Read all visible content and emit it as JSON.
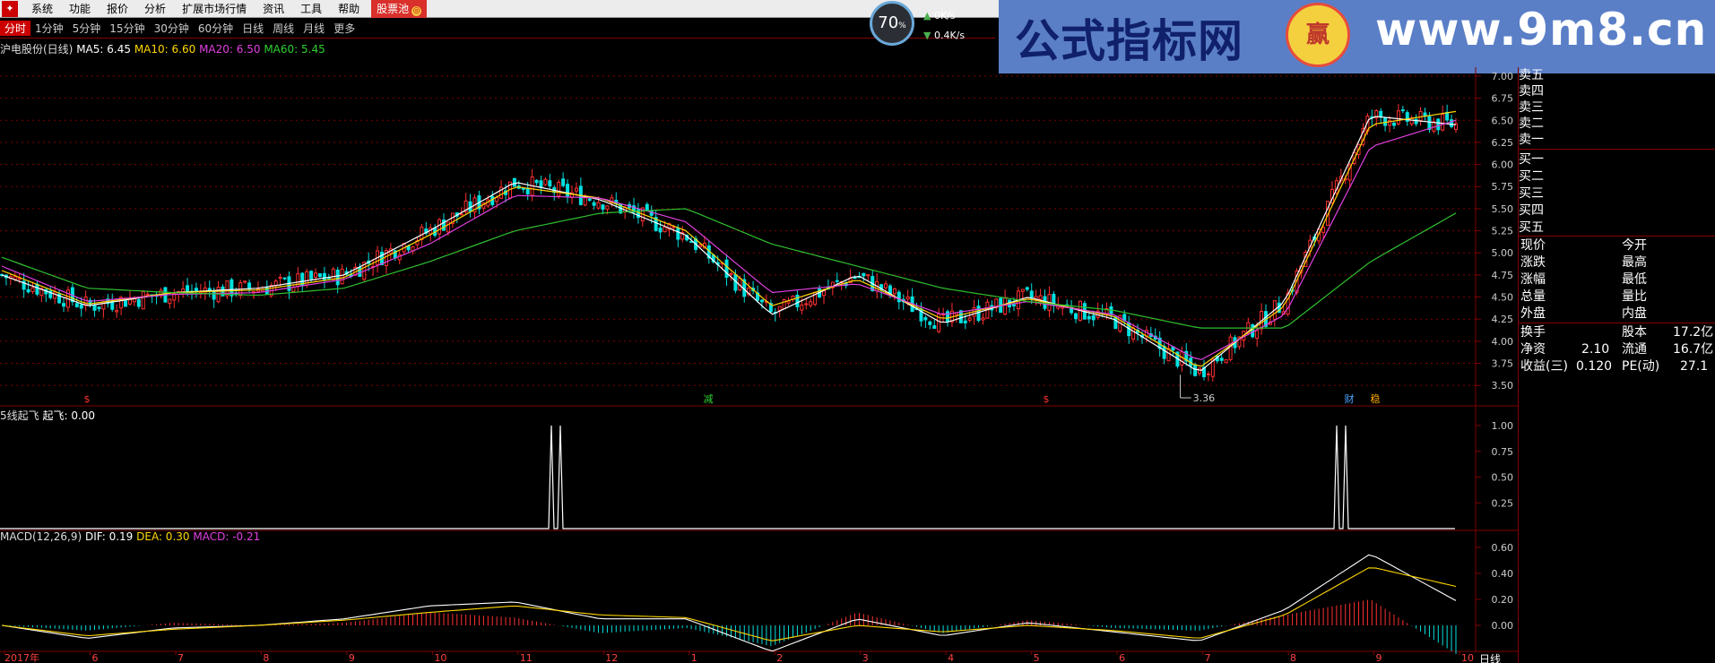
{
  "menu": {
    "items": [
      "系统",
      "功能",
      "报价",
      "分析",
      "扩展市场行情",
      "资讯",
      "工具",
      "帮助"
    ],
    "pool_label": "股票池"
  },
  "periods": [
    "分时",
    "1分钟",
    "5分钟",
    "15分钟",
    "30分钟",
    "60分钟",
    "日线",
    "周线",
    "月线",
    "更多"
  ],
  "speed": {
    "percent": "70",
    "percent_unit": "%",
    "up_rate": "0K/s",
    "down_rate": "0.4K/s"
  },
  "banner": {
    "site_name": "公式指标网",
    "url": "www.9m8.cn",
    "coin_text": "赢"
  },
  "main_panel": {
    "title": "沪电股份(日线)",
    "ma5": "MA5: 6.45",
    "ma10": "MA10: 6.60",
    "ma20": "MA20: 6.50",
    "ma60": "MA60: 5.45",
    "low_label": "3.36",
    "event_marks": [
      "$",
      "减",
      "$",
      "财",
      "稳"
    ],
    "y_ticks": [
      "7.00",
      "6.75",
      "6.50",
      "6.25",
      "6.00",
      "5.75",
      "5.50",
      "5.25",
      "5.00",
      "4.75",
      "4.50",
      "4.25",
      "4.00",
      "3.75",
      "3.50"
    ]
  },
  "indicator_panel": {
    "title": "5线起飞",
    "value_label": "起飞: 0.00",
    "y_ticks": [
      "1.00",
      "0.75",
      "0.50",
      "0.25"
    ]
  },
  "macd_panel": {
    "title": "MACD(12,26,9)",
    "dif": "DIF: 0.19",
    "dea": "DEA: 0.30",
    "macd": "MACD: -0.21",
    "y_ticks": [
      "0.60",
      "0.40",
      "0.20",
      "0.00"
    ]
  },
  "x_axis": {
    "labels": [
      "2017年",
      "6",
      "7",
      "8",
      "9",
      "10",
      "11",
      "12",
      "1",
      "2",
      "3",
      "4",
      "5",
      "6",
      "7",
      "8",
      "9",
      "10"
    ],
    "period_label": "日线"
  },
  "order_book": {
    "sell": [
      "卖五",
      "卖四",
      "卖三",
      "卖二",
      "卖一"
    ],
    "buy": [
      "买一",
      "买二",
      "买三",
      "买四",
      "买五"
    ]
  },
  "quote": {
    "rows": [
      {
        "l1": "现价",
        "v1": "",
        "l2": "今开",
        "v2": ""
      },
      {
        "l1": "涨跌",
        "v1": "",
        "l2": "最高",
        "v2": ""
      },
      {
        "l1": "涨幅",
        "v1": "",
        "l2": "最低",
        "v2": ""
      },
      {
        "l1": "总量",
        "v1": "",
        "l2": "量比",
        "v2": ""
      },
      {
        "l1": "外盘",
        "v1": "",
        "l2": "内盘",
        "v2": ""
      }
    ],
    "fund_rows": [
      {
        "l1": "换手",
        "v1": "",
        "l2": "股本",
        "v2": "17.2亿"
      },
      {
        "l1": "净资",
        "v1": "2.10",
        "l2": "流通",
        "v2": "16.7亿"
      },
      {
        "l1": "收益(三)",
        "v1": "0.120",
        "l2": "PE(动)",
        "v2": "27.1"
      }
    ]
  },
  "colors": {
    "up": "#ff3030",
    "down": "#00e0e0",
    "ma5": "#ffffff",
    "ma10": "#ffd700",
    "ma20": "#e040e0",
    "ma60": "#30c030",
    "grid": "#800000"
  },
  "chart_data": {
    "type": "line",
    "title": "沪电股份(日线)",
    "ylim": [
      3.36,
      7.0
    ],
    "x": [
      "2017年",
      "6",
      "7",
      "8",
      "9",
      "10",
      "11",
      "12",
      "1",
      "2",
      "3",
      "4",
      "5",
      "6",
      "7",
      "8",
      "9",
      "10"
    ],
    "series": [
      {
        "name": "MA5",
        "values": [
          4.75,
          4.4,
          4.55,
          4.6,
          4.75,
          5.25,
          5.8,
          5.6,
          5.2,
          4.3,
          4.75,
          4.2,
          4.5,
          4.25,
          3.65,
          4.45,
          6.55,
          6.45
        ]
      },
      {
        "name": "MA10",
        "values": [
          4.8,
          4.42,
          4.55,
          4.58,
          4.72,
          5.2,
          5.75,
          5.62,
          5.25,
          4.4,
          4.7,
          4.25,
          4.48,
          4.28,
          3.7,
          4.4,
          6.45,
          6.6
        ]
      },
      {
        "name": "MA20",
        "values": [
          4.85,
          4.45,
          4.53,
          4.55,
          4.7,
          5.1,
          5.65,
          5.62,
          5.35,
          4.55,
          4.65,
          4.3,
          4.45,
          4.3,
          3.78,
          4.3,
          6.2,
          6.5
        ]
      },
      {
        "name": "MA60",
        "values": [
          4.95,
          4.6,
          4.55,
          4.52,
          4.6,
          4.9,
          5.25,
          5.45,
          5.5,
          5.1,
          4.85,
          4.6,
          4.45,
          4.35,
          4.15,
          4.15,
          4.9,
          5.45
        ]
      }
    ],
    "macd": {
      "dif": [
        0.0,
        -0.1,
        -0.02,
        0.0,
        0.05,
        0.15,
        0.18,
        0.05,
        0.05,
        -0.2,
        0.05,
        -0.08,
        0.02,
        -0.05,
        -0.12,
        0.12,
        0.55,
        0.19
      ],
      "dea": [
        0.0,
        -0.08,
        -0.03,
        0.0,
        0.04,
        0.1,
        0.15,
        0.08,
        0.06,
        -0.12,
        0.0,
        -0.05,
        0.0,
        -0.04,
        -0.1,
        0.08,
        0.45,
        0.3
      ]
    },
    "signal": {
      "name": "起飞",
      "spikes_at": [
        "11",
        "9"
      ],
      "value": 1.0
    }
  }
}
